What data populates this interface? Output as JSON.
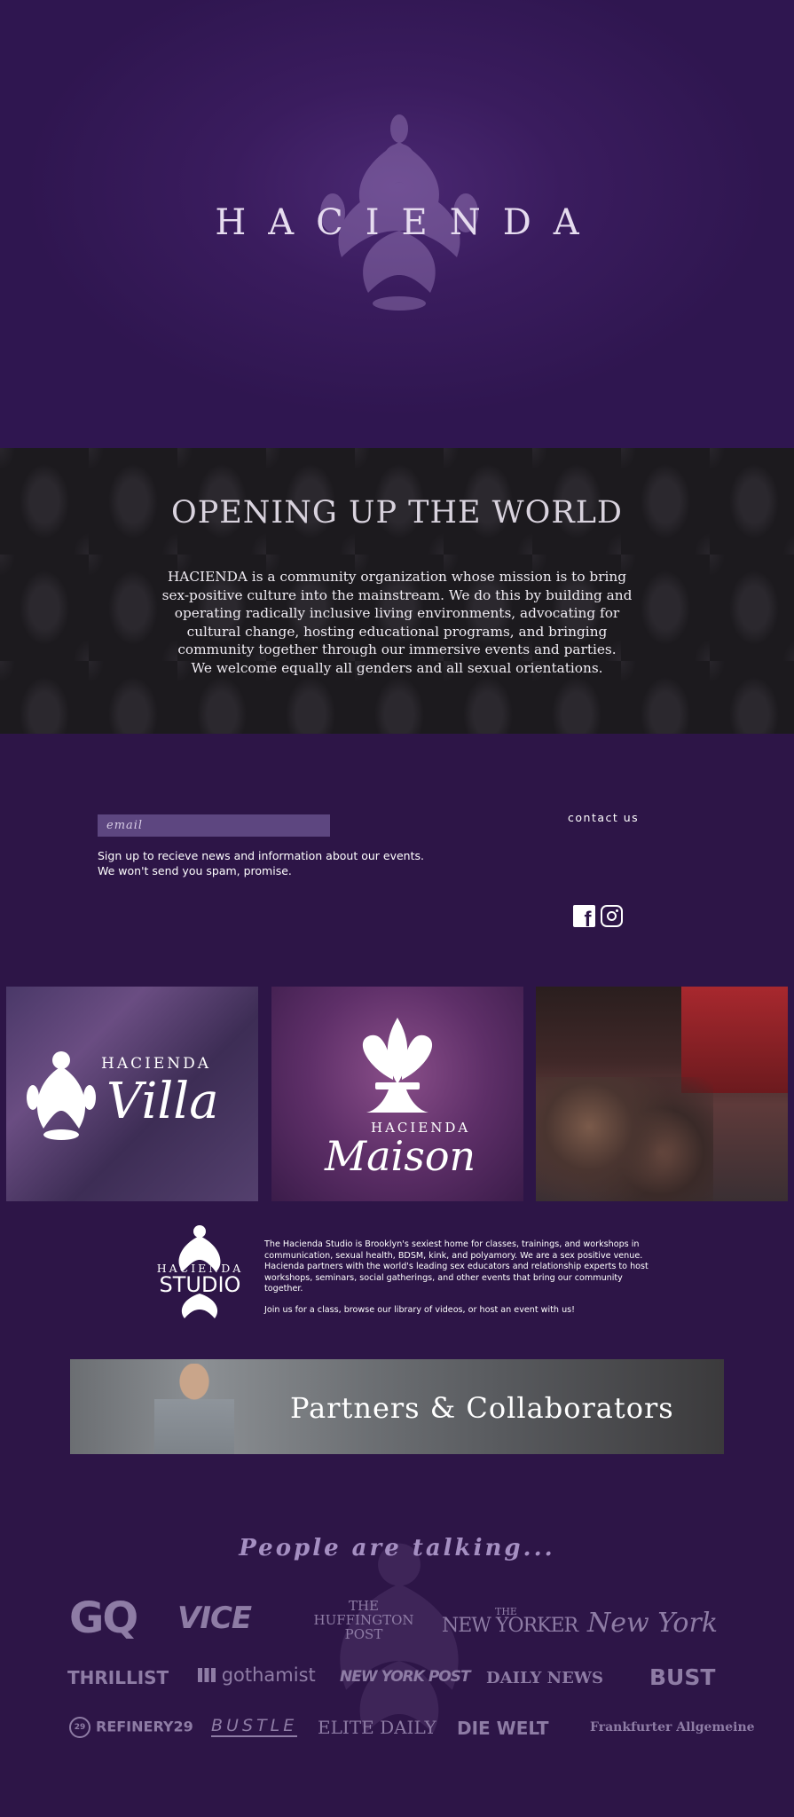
{
  "hero": {
    "title": "HACIENDA"
  },
  "intro": {
    "heading": "OPENING UP THE WORLD",
    "lines": [
      "HACIENDA is a community organization whose mission is to bring",
      "sex-positive culture into the mainstream. We do this by building and",
      "operating radically inclusive living environments, advocating for",
      "cultural change, hosting educational programs, and bringing",
      "community together through our immersive events and parties.",
      "We welcome equally all genders and all sexual orientations."
    ]
  },
  "signup": {
    "placeholder": "email",
    "line1": "Sign up to recieve news and information about our events.",
    "line2": "We won't send you spam, promise."
  },
  "contact": {
    "label": "contact us"
  },
  "social": {
    "facebook_icon": "facebook-icon",
    "instagram_icon": "instagram-icon"
  },
  "tiles": {
    "villa": {
      "top": "HACIENDA",
      "script": "Villa"
    },
    "maison": {
      "top": "HACIENDA",
      "script": "Maison"
    }
  },
  "studio": {
    "logo_top": "HACIENDA",
    "logo_bottom": "STUDIO",
    "paragraph1": "The Hacienda Studio is Brooklyn's sexiest home for classes, trainings, and workshops in communication, sexual health, BDSM, kink, and polyamory. We are a sex positive venue. Hacienda partners with the world's leading sex educators and relationship experts to host workshops, seminars, social gatherings, and other events that bring our community together.",
    "paragraph2": "Join us for a class, browse our library of videos, or host an event with us!"
  },
  "partners": {
    "title": "Partners & Collaborators"
  },
  "press": {
    "heading": "People are talking...",
    "logos": {
      "gq": "GQ",
      "vice": "VICE",
      "huffington": [
        "THE",
        "HUFFINGTON",
        "POST"
      ],
      "newyorker_small": "THE",
      "newyorker": "NEW YORKER",
      "newyork": "New York",
      "thrillist": "THRILLIST",
      "gothamist": "gothamist",
      "nypost": "NEW YORK POST",
      "dailynews": "DAILY NEWS",
      "bust": "BUST",
      "refinery": "REFINERY29",
      "refinery_badge": "29",
      "bustle": "BUSTLE",
      "elitedaily": "ELITE DAILY",
      "diewelt": "DIE WELT",
      "faz": "Frankfurter Allgemeine"
    },
    "color": "#8e7ca5"
  },
  "colors": {
    "background": "#2d1547",
    "hero": "#3a1c5e",
    "damask": "#1c1a1e",
    "email_field": "#5d4680"
  }
}
